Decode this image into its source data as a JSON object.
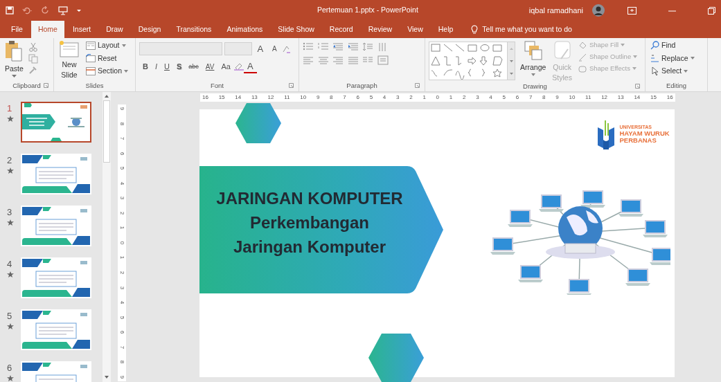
{
  "window": {
    "title": "Pertemuan 1.pptx  -  PowerPoint",
    "user": "iqbal ramadhani"
  },
  "tabs": [
    {
      "label": "File",
      "selected": false
    },
    {
      "label": "Home",
      "selected": true
    },
    {
      "label": "Insert",
      "selected": false
    },
    {
      "label": "Draw",
      "selected": false
    },
    {
      "label": "Design",
      "selected": false
    },
    {
      "label": "Transitions",
      "selected": false
    },
    {
      "label": "Animations",
      "selected": false
    },
    {
      "label": "Slide Show",
      "selected": false
    },
    {
      "label": "Record",
      "selected": false
    },
    {
      "label": "Review",
      "selected": false
    },
    {
      "label": "View",
      "selected": false
    },
    {
      "label": "Help",
      "selected": false
    }
  ],
  "tell_me": "Tell me what you want to do",
  "ribbon": {
    "clipboard": {
      "label": "Clipboard",
      "paste": "Paste"
    },
    "slides": {
      "label": "Slides",
      "new_slide": [
        "New",
        "Slide"
      ],
      "small": [
        {
          "label": "Layout"
        },
        {
          "label": "Reset"
        },
        {
          "label": "Section"
        }
      ]
    },
    "font": {
      "label": "Font",
      "grow": "A",
      "shrink": "A",
      "format": [
        {
          "kind": "bold",
          "label": "B"
        },
        {
          "kind": "italic",
          "label": "I"
        },
        {
          "kind": "underline",
          "label": "U"
        },
        {
          "kind": "shadow",
          "label": "S"
        },
        {
          "kind": "strike",
          "label": "abc"
        },
        {
          "kind": "spacing",
          "label": "AV"
        },
        {
          "kind": "case",
          "label": "Aa"
        },
        {
          "kind": "color",
          "label": "A"
        }
      ]
    },
    "paragraph": {
      "label": "Paragraph"
    },
    "drawing": {
      "label": "Drawing",
      "arrange": "Arrange",
      "quick_styles": {
        "label": [
          "Quick",
          "Styles"
        ],
        "disabled": true
      },
      "shape_tools": [
        {
          "label": "Shape Fill",
          "disabled": true
        },
        {
          "label": "Shape Outline",
          "disabled": true
        },
        {
          "label": "Shape Effects",
          "disabled": true
        }
      ]
    },
    "editing": {
      "label": "Editing",
      "items": [
        {
          "kind": "find",
          "label": "Find"
        },
        {
          "kind": "replace",
          "label": "Replace"
        },
        {
          "kind": "select",
          "label": "Select"
        }
      ]
    }
  },
  "thumbnails": [
    {
      "number": "1",
      "kind": "title",
      "selected": true
    },
    {
      "number": "2",
      "kind": "content",
      "selected": false
    },
    {
      "number": "3",
      "kind": "content",
      "selected": false
    },
    {
      "number": "4",
      "kind": "content",
      "selected": false
    },
    {
      "number": "5",
      "kind": "content",
      "selected": false
    },
    {
      "number": "6",
      "kind": "content",
      "selected": false
    }
  ],
  "ruler_h": [
    "16",
    "15",
    "14",
    "13",
    "12",
    "11",
    "10",
    "9",
    "8",
    "7",
    "6",
    "5",
    "4",
    "3",
    "2",
    "1",
    "0",
    "1",
    "2",
    "3",
    "4",
    "5",
    "6",
    "7",
    "8",
    "9",
    "10",
    "11",
    "12",
    "13",
    "14",
    "15",
    "16"
  ],
  "ruler_v": [
    "9",
    "8",
    "7",
    "6",
    "5",
    "4",
    "3",
    "2",
    "1",
    "0",
    "1",
    "2",
    "3",
    "4",
    "5",
    "6",
    "7",
    "8",
    "9"
  ],
  "slide": {
    "title_lines": [
      "JARINGAN KOMPUTER",
      "Perkembangan",
      "Jaringan Komputer"
    ],
    "logo": {
      "small": "UNIVERSITAS",
      "lines": [
        "HAYAM WURUK",
        "PERBANAS"
      ]
    }
  }
}
